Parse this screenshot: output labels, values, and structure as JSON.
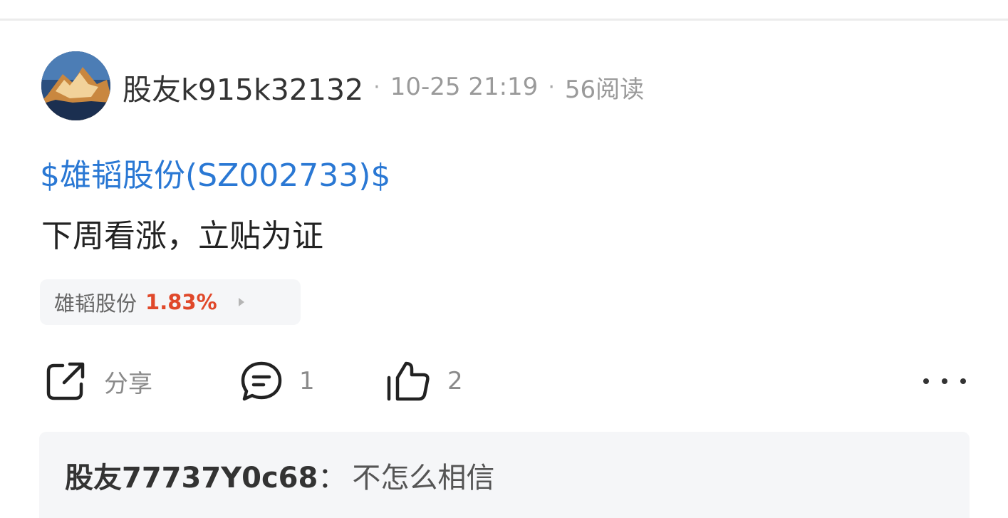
{
  "post": {
    "author": "股友k915k32132",
    "separator": "·",
    "timestamp": "10-25 21:19",
    "reads": "56阅读",
    "stock_link": "$雄韬股份(SZ002733)$",
    "text": "下周看涨，立贴为证"
  },
  "stock_tag": {
    "name": "雄韬股份",
    "change": "1.83%",
    "change_color": "#e0482a"
  },
  "actions": {
    "share_label": "分享",
    "comment_count": "1",
    "like_count": "2"
  },
  "icons": {
    "share": "share-icon",
    "comment": "comment-icon",
    "like": "thumbs-up-icon",
    "more": "more-dots-icon"
  },
  "comment": {
    "author": "股友77737Y0c68",
    "colon": "：",
    "text": "不怎么相信"
  },
  "colors": {
    "link": "#2a78d4",
    "rise": "#e0482a",
    "muted": "#9a9a9a"
  }
}
